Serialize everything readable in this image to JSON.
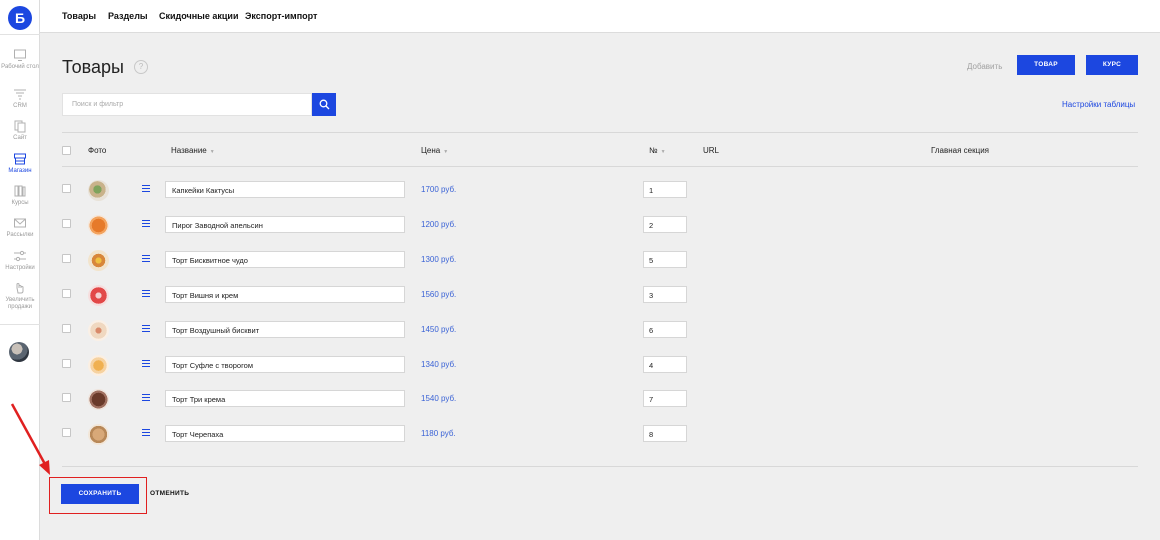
{
  "brand": {
    "logo_letter": "Б",
    "accent": "#1c47e0"
  },
  "topnav": [
    "Товары",
    "Разделы",
    "Скидочные акции",
    "Экспорт-импорт"
  ],
  "sidebar": [
    {
      "label": "Рабочий стол",
      "icon": "monitor-icon"
    },
    {
      "label": "CRM",
      "icon": "funnel-icon"
    },
    {
      "label": "Сайт",
      "icon": "pages-icon"
    },
    {
      "label": "Магазин",
      "icon": "shop-icon",
      "active": true
    },
    {
      "label": "Курсы",
      "icon": "books-icon"
    },
    {
      "label": "Рассылки",
      "icon": "mail-icon"
    },
    {
      "label": "Настройки",
      "icon": "sliders-icon"
    },
    {
      "label": "Увеличить продажи",
      "icon": "hand-icon"
    }
  ],
  "page": {
    "title": "Товары",
    "help": "?",
    "add_label": "Добавить",
    "btn_product": "ТОВАР",
    "btn_course": "КУРС",
    "search_placeholder": "Поиск и фильтр",
    "table_settings": "Настройки таблицы"
  },
  "table": {
    "headers": {
      "photo": "Фото",
      "name": "Название",
      "price": "Цена",
      "num": "№",
      "url": "URL",
      "section": "Главная секция"
    },
    "rows": [
      {
        "name": "Капкейки Кактусы",
        "price": "1700 руб.",
        "num": "1",
        "photo": "cactus-cupcakes"
      },
      {
        "name": "Пирог Заводной апельсин",
        "price": "1200 руб.",
        "num": "2",
        "photo": "orange-pie"
      },
      {
        "name": "Торт Бисквитное чудо",
        "price": "1300 руб.",
        "num": "5",
        "photo": "sponge-cake"
      },
      {
        "name": "Торт Вишня и крем",
        "price": "1560 руб.",
        "num": "3",
        "photo": "cherry-cake"
      },
      {
        "name": "Торт Воздушный бисквит",
        "price": "1450 руб.",
        "num": "6",
        "photo": "airy-sponge"
      },
      {
        "name": "Торт Суфле с творогом",
        "price": "1340 руб.",
        "num": "4",
        "photo": "souffle-cake"
      },
      {
        "name": "Торт Три крема",
        "price": "1540 руб.",
        "num": "7",
        "photo": "three-cream-cake"
      },
      {
        "name": "Торт Черепаха",
        "price": "1180 руб.",
        "num": "8",
        "photo": "turtle-cake"
      }
    ]
  },
  "footer": {
    "save": "СОХРАНИТЬ",
    "cancel": "ОТМЕНИТЬ"
  }
}
